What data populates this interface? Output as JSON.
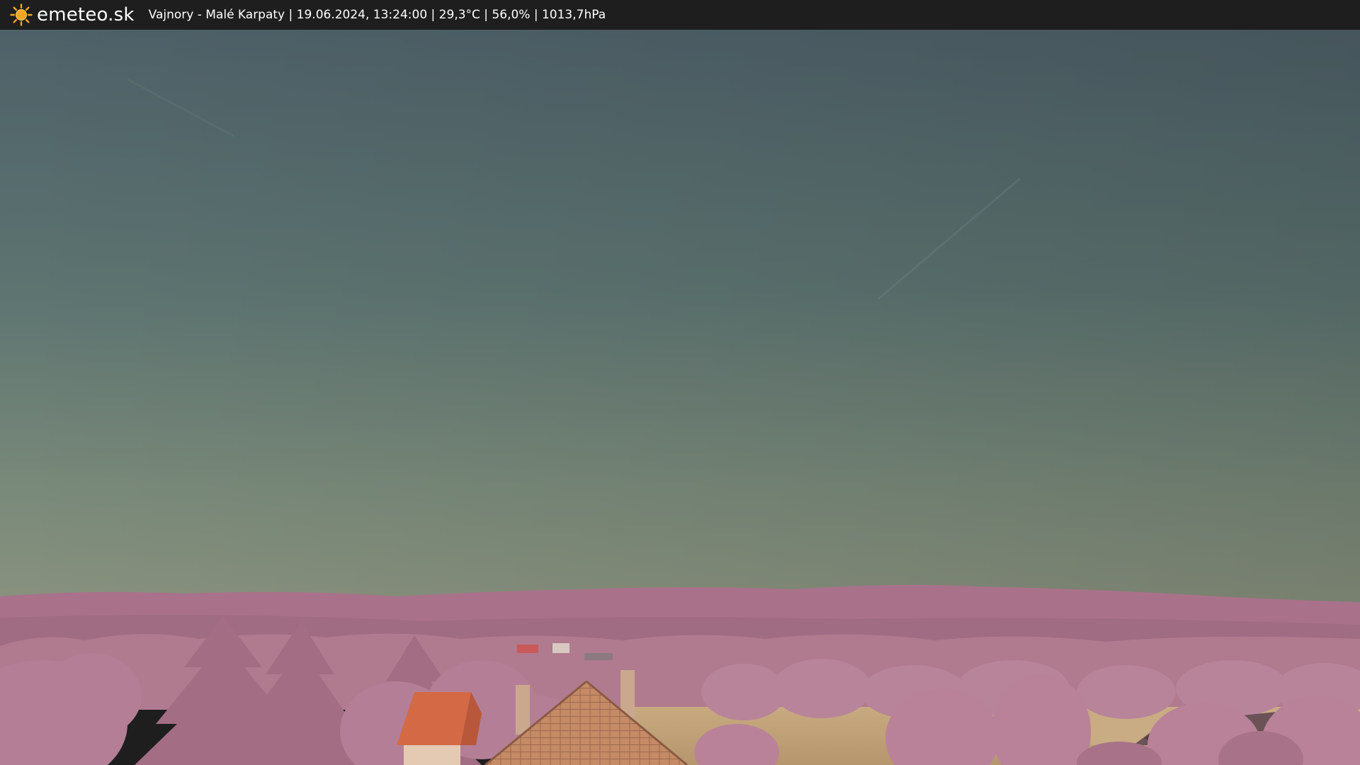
{
  "header": {
    "brand": "emeteo.sk",
    "caption": "Vajnory - Malé Karpaty | 19.06.2024, 13:24:00 | 29,3°C | 56,0% | 1013,7hPa",
    "logo_icon": "sun-icon"
  },
  "colors": {
    "bar_bg": "#1e1e1e",
    "sun": "#f5a623",
    "sky_top": "#4f6268",
    "sky_bottom": "#7d8c7a",
    "foliage": "#b87f93",
    "field": "#c2a37a",
    "roof": "#d46a45"
  }
}
